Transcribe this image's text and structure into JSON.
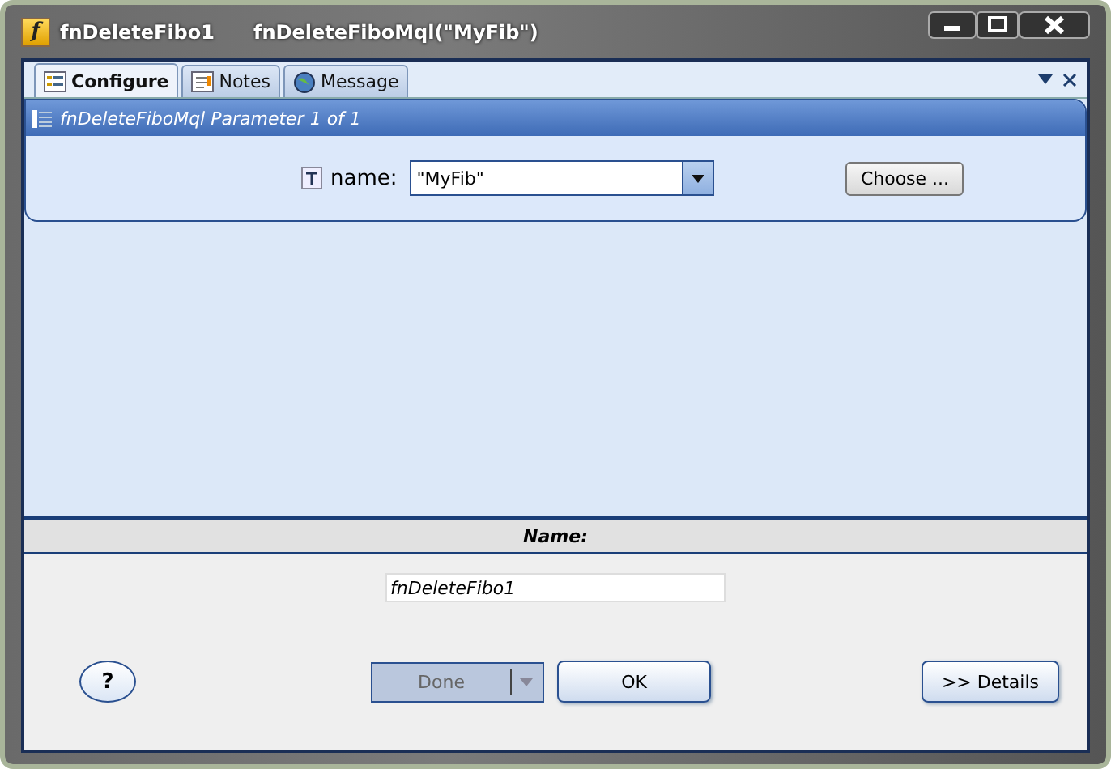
{
  "window": {
    "icon_letter": "f",
    "title": "fnDeleteFibo1",
    "subtitle": "fnDeleteFiboMql(\"MyFib\")"
  },
  "tabs": [
    {
      "label": "Configure",
      "selected": true
    },
    {
      "label": "Notes",
      "selected": false
    },
    {
      "label": "Message",
      "selected": false
    }
  ],
  "parameter_panel": {
    "header": "fnDeleteFiboMql Parameter 1 of 1",
    "label": "name:",
    "value": "\"MyFib\"",
    "choose_button": "Choose ..."
  },
  "name_section": {
    "heading": "Name:",
    "value": "fnDeleteFibo1"
  },
  "buttons": {
    "help": "?",
    "done": {
      "label": "Done",
      "disabled": true
    },
    "ok": "OK",
    "details": ">> Details"
  }
}
